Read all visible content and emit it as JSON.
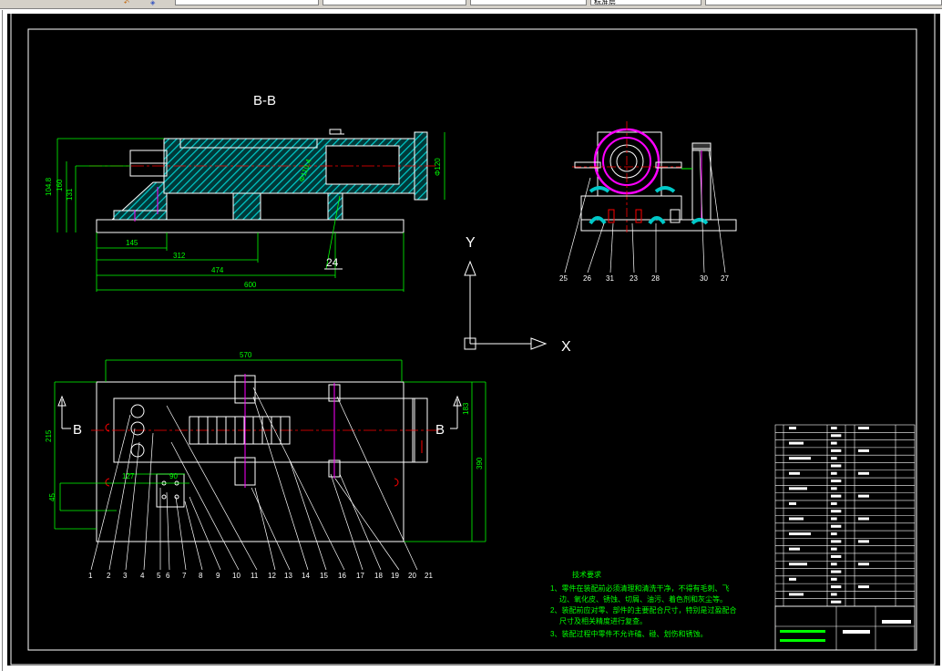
{
  "toolbar": {
    "icon_names": [
      "undo-icon",
      "layer-icon"
    ],
    "fields": [
      "",
      "",
      "",
      "",
      "标准层"
    ]
  },
  "drawing": {
    "section_title": "B-B",
    "section_marker": "B",
    "axis_x": "X",
    "axis_y": "Y",
    "top_view_dims": {
      "d1": "104.8",
      "d2": "160",
      "d3": "131",
      "d4": "Φ120",
      "w1": "145",
      "w2": "312",
      "w3": "474",
      "w4": "600",
      "callout": "24",
      "inner": "Φ110.4"
    },
    "plan_dims": {
      "top": "570",
      "h1": "215",
      "h2": "390",
      "h3": "183",
      "h4": "45",
      "h5": "127",
      "h6": "90",
      "h7": "5"
    },
    "part_labels": [
      "1",
      "2",
      "3",
      "4",
      "5",
      "6",
      "7",
      "8",
      "9",
      "10",
      "11",
      "12",
      "13",
      "14",
      "15",
      "16",
      "17",
      "18",
      "19",
      "20",
      "21"
    ],
    "side_labels": [
      "25",
      "26",
      "31",
      "23",
      "28",
      "30",
      "27"
    ],
    "notes_title": "技术要求",
    "notes": [
      "1、零件在装配前必须清理和清洗干净，不得有毛刺、飞",
      "边、氧化皮、锈蚀、切屑、油污、着色剂和灰尘等。",
      "2、装配前应对零、部件的主要配合尺寸，特别是过盈配合",
      "尺寸及相关精度进行复查。",
      "3、装配过程中零件不允许磕、碰、划伤和锈蚀。"
    ]
  },
  "colors": {
    "background": "#000000",
    "outline": "#ffffff",
    "hatch": "#00c8c8",
    "dimension": "#00ff00",
    "center_line": "#ff0000",
    "magenta": "#ff00ff",
    "blue": "#0080ff",
    "yellow": "#ffff00"
  }
}
